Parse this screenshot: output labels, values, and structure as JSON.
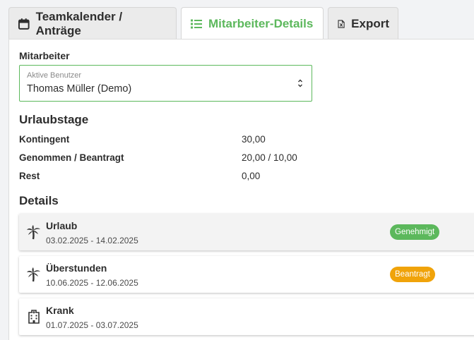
{
  "tabs": [
    {
      "label": "Teamkalender / Anträge",
      "icon": "calendar-icon",
      "active": false
    },
    {
      "label": "Mitarbeiter-Details",
      "icon": "list-icon",
      "active": true
    },
    {
      "label": "Export",
      "icon": "excel-file-icon",
      "active": false
    }
  ],
  "employee": {
    "label": "Mitarbeiter",
    "select_caption": "Aktive Benutzer",
    "select_value": "Thomas Müller (Demo)"
  },
  "vacation": {
    "heading": "Urlaubstage",
    "rows": [
      {
        "key": "Kontingent",
        "value": "30,00"
      },
      {
        "key": "Genommen / Beantragt",
        "value": "20,00 / 10,00"
      },
      {
        "key": "Rest",
        "value": "0,00"
      }
    ]
  },
  "details": {
    "heading": "Details",
    "items": [
      {
        "title": "Urlaub",
        "dates": "03.02.2025 - 14.02.2025",
        "icon": "palm-tree-icon",
        "status": "Genehmigt",
        "status_color": "#5cb85c"
      },
      {
        "title": "Überstunden",
        "dates": "10.06.2025 - 12.06.2025",
        "icon": "palm-tree-icon",
        "status": "Beantragt",
        "status_color": "#f0a30a"
      },
      {
        "title": "Krank",
        "dates": "01.07.2025 - 03.07.2025",
        "icon": "hospital-icon",
        "status": "",
        "status_color": ""
      }
    ]
  },
  "colors": {
    "accent": "#5cb85c",
    "pending": "#f0a30a"
  }
}
